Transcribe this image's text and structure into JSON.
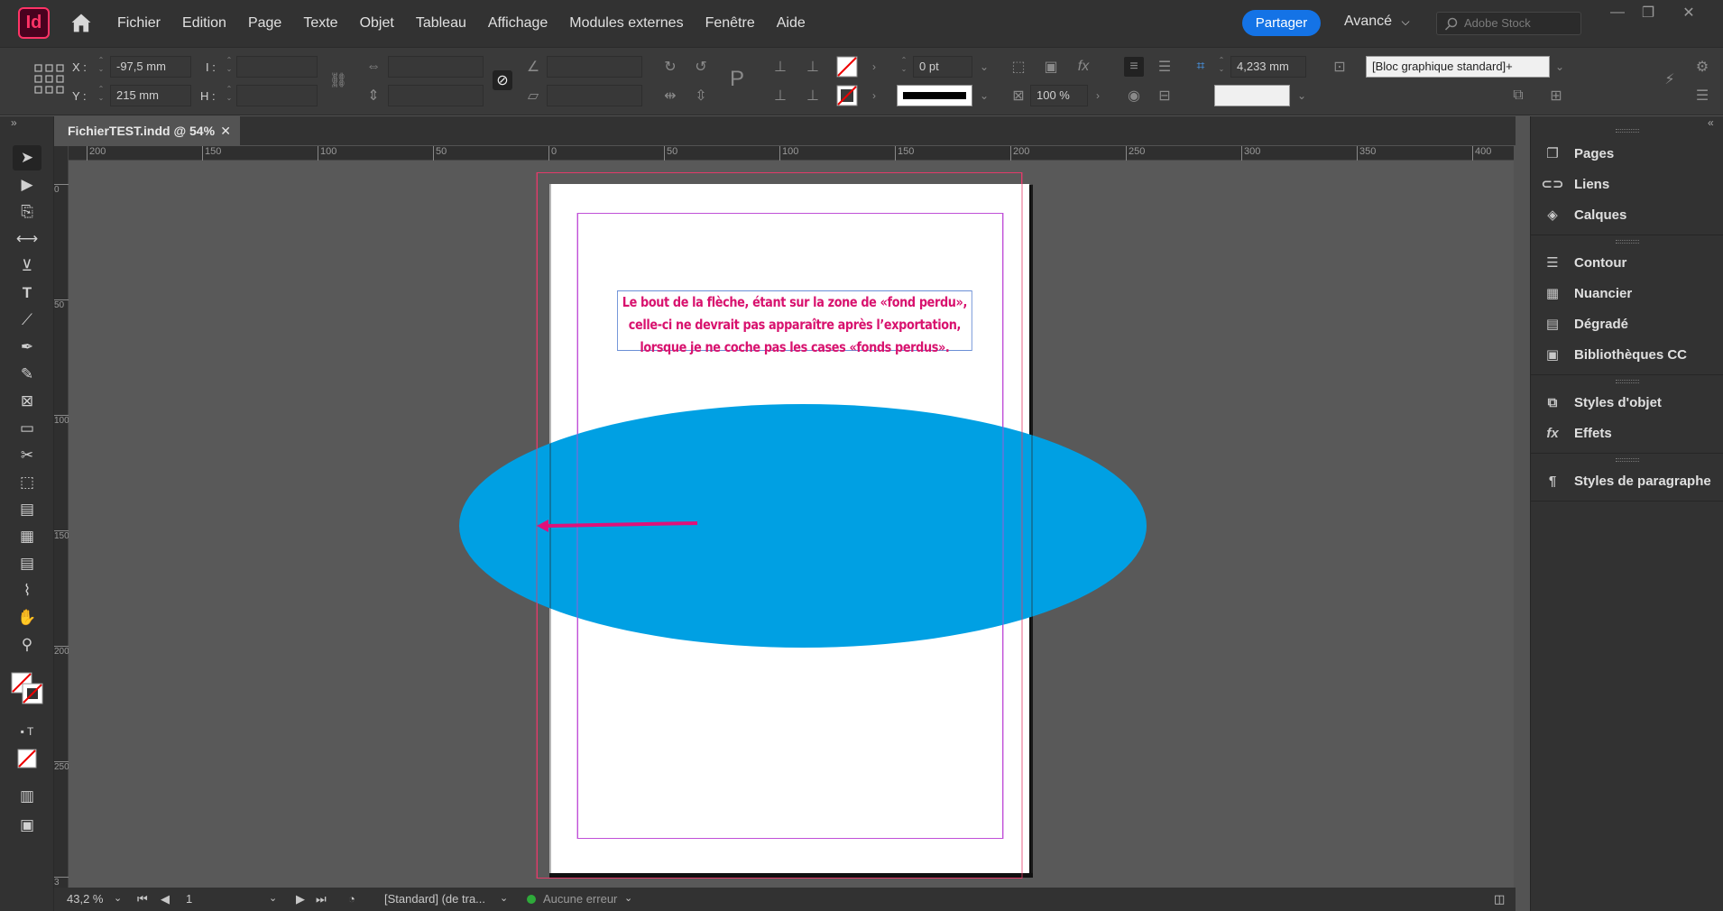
{
  "app": {
    "logo": "Id"
  },
  "menu": [
    "Fichier",
    "Edition",
    "Page",
    "Texte",
    "Objet",
    "Tableau",
    "Affichage",
    "Modules externes",
    "Fenêtre",
    "Aide"
  ],
  "topbar": {
    "share": "Partager",
    "workspace": "Avancé",
    "search_placeholder": "Adobe Stock"
  },
  "control": {
    "x_label": "X :",
    "x_value": "-97,5 mm",
    "y_label": "Y :",
    "y_value": "215 mm",
    "w_label": "I :",
    "h_label": "H :",
    "stroke_weight": "0 pt",
    "scale": "100 %",
    "size": "4,233 mm",
    "object_style": "[Bloc graphique standard]+"
  },
  "document": {
    "tab_title": "FichierTEST.indd @ 54%",
    "tab_close": "✕",
    "text_lines": [
      "Le bout de la flèche, étant sur la zone de «fond perdu»,",
      "celle-ci ne devrait pas apparaître après l’exportation,",
      "lorsque je ne coche pas les cases «fonds perdus»."
    ],
    "ellipse_color": "#00a0e3",
    "arrow_color": "#e0107a"
  },
  "ruler_h": [
    "200",
    "150",
    "100",
    "50",
    "0",
    "50",
    "100",
    "150",
    "200",
    "250",
    "300",
    "350",
    "400"
  ],
  "ruler_v": [
    "0",
    "50",
    "100",
    "150",
    "200",
    "250",
    "3"
  ],
  "status": {
    "zoom": "43,2 %",
    "page": "1",
    "style": "[Standard] (de tra...",
    "preflight": "Aucune erreur"
  },
  "panels": {
    "group1": [
      "Pages",
      "Liens",
      "Calques"
    ],
    "group2": [
      "Contour",
      "Nuancier",
      "Dégradé",
      "Bibliothèques CC"
    ],
    "group3": [
      "Styles d'objet",
      "Effets"
    ],
    "group4": [
      "Styles de paragraphe"
    ]
  }
}
